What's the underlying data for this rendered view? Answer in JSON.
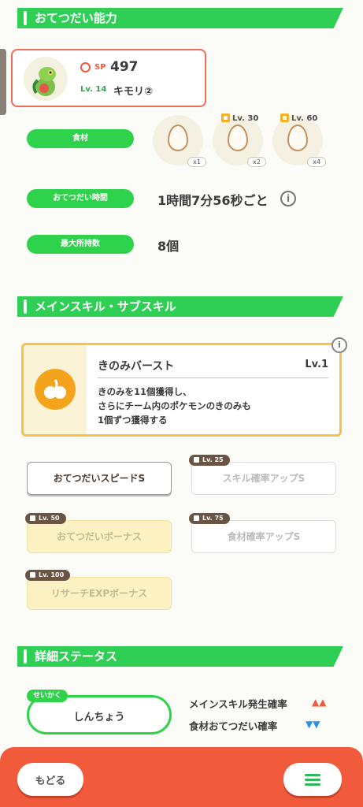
{
  "sections": {
    "help_ability": "おてつだい能力",
    "skills": "メインスキル・サブスキル",
    "status": "詳細ステータス"
  },
  "pokemon": {
    "sp_label": "SP",
    "sp_value": "497",
    "level": "Lv. 14",
    "name": "キモリ②"
  },
  "ingredients": {
    "label": "食材",
    "items": [
      {
        "qty": "x1",
        "unlock": ""
      },
      {
        "qty": "x2",
        "unlock": "Lv. 30"
      },
      {
        "qty": "x4",
        "unlock": "Lv. 60"
      }
    ]
  },
  "help_time": {
    "label": "おてつだい時間",
    "value": "1時間7分56秒ごと"
  },
  "max_carry": {
    "label": "最大所持数",
    "value": "8個"
  },
  "main_skill": {
    "name": "きのみバースト",
    "level": "Lv.1",
    "description_line1": "きのみを11個獲得し、",
    "description_line2": "さらにチーム内のポケモンのきのみも",
    "description_line3": "1個ずつ獲得する"
  },
  "sub_skills": [
    {
      "label": "おてつだいスピードS",
      "lock": ""
    },
    {
      "label": "スキル確率アップS",
      "lock": "Lv. 25"
    },
    {
      "label": "おてつだいボーナス",
      "lock": "Lv. 50"
    },
    {
      "label": "食材確率アップS",
      "lock": "Lv. 75"
    },
    {
      "label": "リサーチEXPボーナス",
      "lock": "Lv. 100"
    }
  ],
  "nature": {
    "tag": "せいかく",
    "value": "しんちょう",
    "up_label": "メインスキル発生確率",
    "up_marks": "▲▲",
    "down_label": "食材おてつだい確率",
    "down_marks": "▼▼"
  },
  "footer": {
    "back_label": "もどる"
  },
  "colors": {
    "green": "#2fcf56",
    "orange_footer": "#f25a3c",
    "skill_border": "#f6c34a",
    "up": "#f25a3c",
    "down": "#2f8fe8"
  }
}
